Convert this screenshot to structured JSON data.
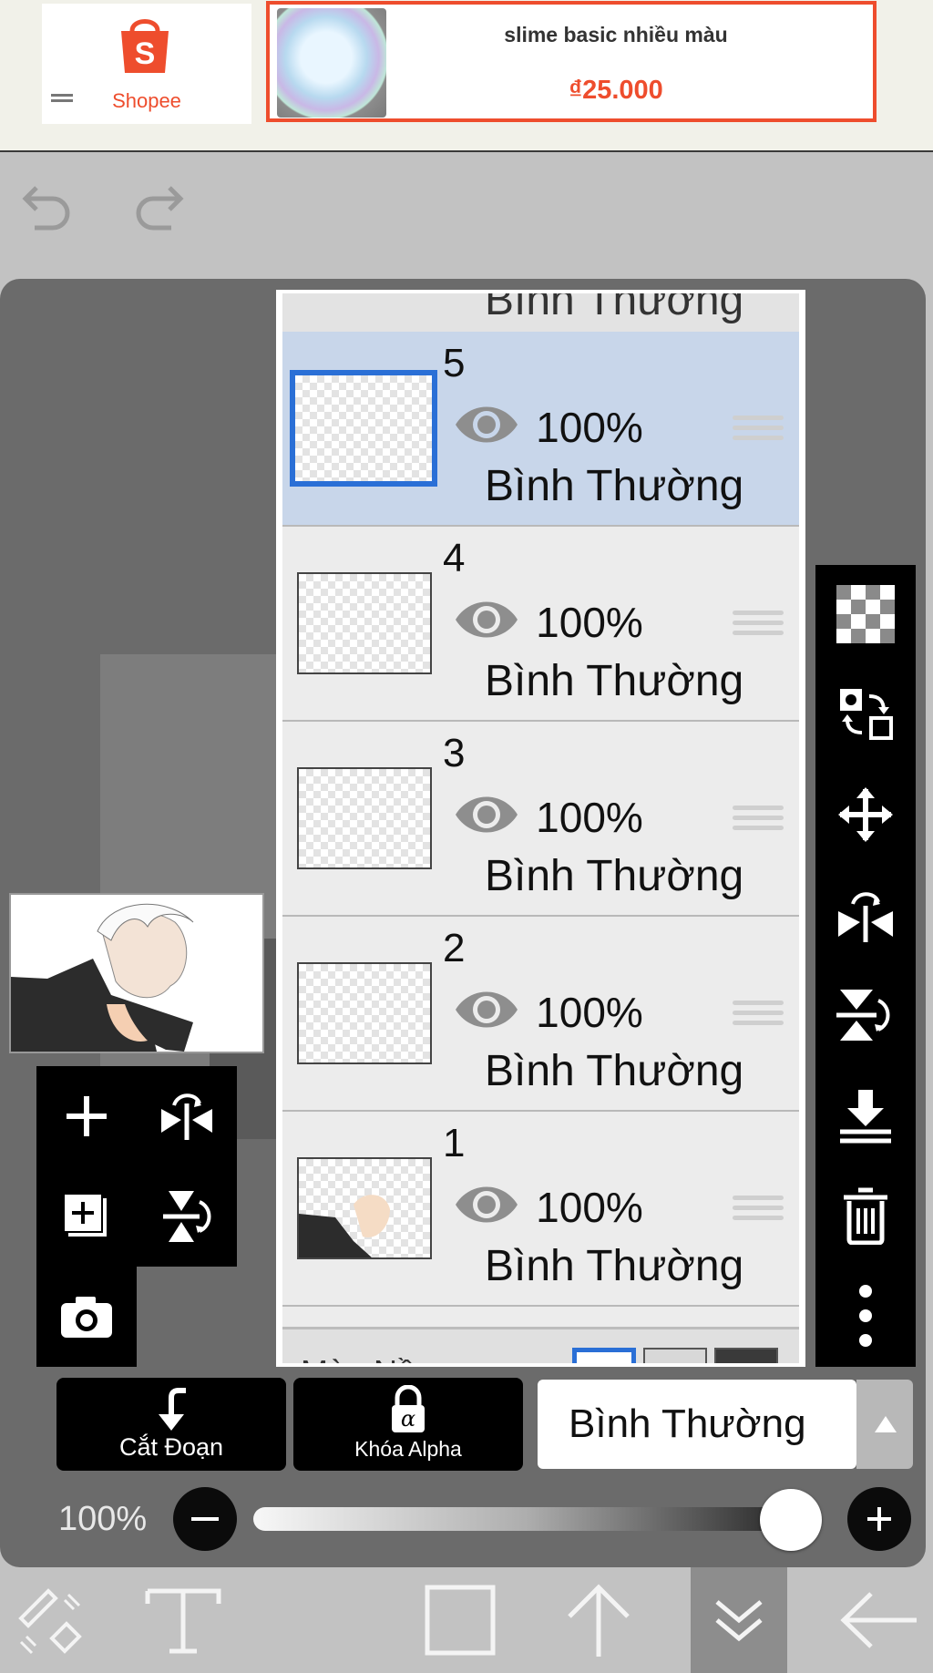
{
  "ad": {
    "brand": "Shopee",
    "product_title": "slime basic nhiều màu",
    "price": "₫25.000"
  },
  "layers": [
    {
      "number": "5",
      "opacity": "100%",
      "blend": "Bình Thường",
      "selected": true
    },
    {
      "number": "4",
      "opacity": "100%",
      "blend": "Bình Thường",
      "selected": false
    },
    {
      "number": "3",
      "opacity": "100%",
      "blend": "Bình Thường",
      "selected": false
    },
    {
      "number": "2",
      "opacity": "100%",
      "blend": "Bình Thường",
      "selected": false
    },
    {
      "number": "1",
      "opacity": "100%",
      "blend": "Bình Thường",
      "selected": false
    }
  ],
  "top_partial_layer_blend": "Bình Thường",
  "background_row_label": "Màu Nền",
  "controls": {
    "clip_label": "Cắt Đoạn",
    "alpha_lock_label": "Khóa Alpha",
    "blend_mode": "Bình Thường",
    "opacity_label": "100%",
    "opacity_value": 1.0
  },
  "colors": {
    "brand": "#ee4d2d",
    "selection": "#2a6fd6",
    "selected_layer_bg": "#c8d6ea"
  }
}
